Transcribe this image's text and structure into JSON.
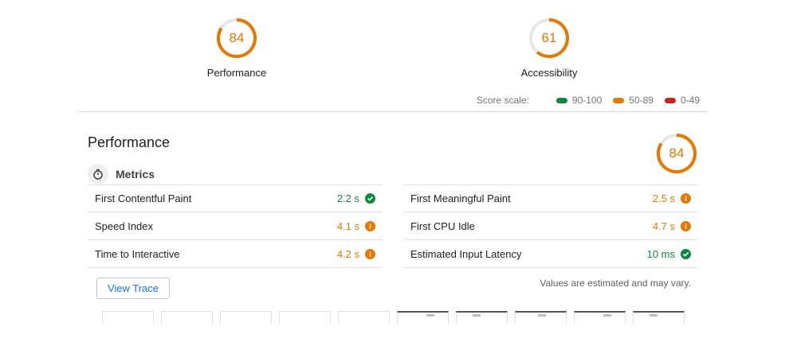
{
  "gauges": [
    {
      "score": "84",
      "label": "Performance",
      "value": 84,
      "color": "#e67700"
    },
    {
      "score": "61",
      "label": "Accessibility",
      "value": 61,
      "color": "#e67700"
    }
  ],
  "score_scale": {
    "title": "Score scale:",
    "ranges": [
      {
        "label": "90-100",
        "color": "#0a8a3c"
      },
      {
        "label": "50-89",
        "color": "#e67700"
      },
      {
        "label": "0-49",
        "color": "#cc1f1f"
      }
    ]
  },
  "section": {
    "title": "Performance",
    "score": "84",
    "value": 84,
    "metrics_label": "Metrics",
    "metrics_icon": "stopwatch-icon"
  },
  "metrics_left": [
    {
      "name": "First Contentful Paint",
      "value": "2.2 s",
      "status": "green",
      "icon": "check-icon"
    },
    {
      "name": "Speed Index",
      "value": "4.1 s",
      "status": "orange",
      "icon": "info-icon"
    },
    {
      "name": "Time to Interactive",
      "value": "4.2 s",
      "status": "orange",
      "icon": "info-icon"
    }
  ],
  "metrics_right": [
    {
      "name": "First Meaningful Paint",
      "value": "2.5 s",
      "status": "orange",
      "icon": "info-icon"
    },
    {
      "name": "First CPU Idle",
      "value": "4.7 s",
      "status": "orange",
      "icon": "info-icon"
    },
    {
      "name": "Estimated Input Latency",
      "value": "10 ms",
      "status": "green",
      "icon": "check-icon"
    }
  ],
  "view_trace_label": "View Trace",
  "note": "Values are estimated and may vary.",
  "filmstrip_frames": [
    "blank",
    "blank",
    "blank",
    "blank",
    "blank",
    "loaded",
    "loaded",
    "loaded",
    "loaded",
    "loaded"
  ]
}
